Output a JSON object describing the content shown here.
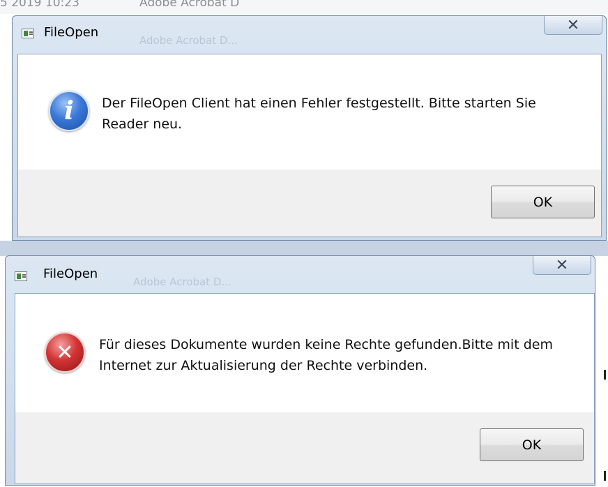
{
  "background": {
    "date_text": "5 2019 10:23",
    "app_text": "Adobe Acrobat D",
    "ghost_text": "Adobe Acrobat D..."
  },
  "dialogs": [
    {
      "title": "FileOpen",
      "icon": "info-icon",
      "message": "Der FileOpen Client hat einen Fehler festgestellt. Bitte starten Sie Reader neu.",
      "ok_label": "OK",
      "close_glyph": "✕"
    },
    {
      "title": "FileOpen",
      "icon": "error-icon",
      "message": "Für dieses Dokumente wurden keine Rechte gefunden.Bitte mit dem Internet zur Aktualisierung der Rechte verbinden.",
      "ok_label": "OK",
      "close_glyph": "✕"
    }
  ],
  "colors": {
    "title_bar": "#c9d8ea",
    "client": "#ffffff",
    "footer": "#f0f0f0",
    "info_blue": "#3b78d8",
    "error_red": "#d33434"
  }
}
